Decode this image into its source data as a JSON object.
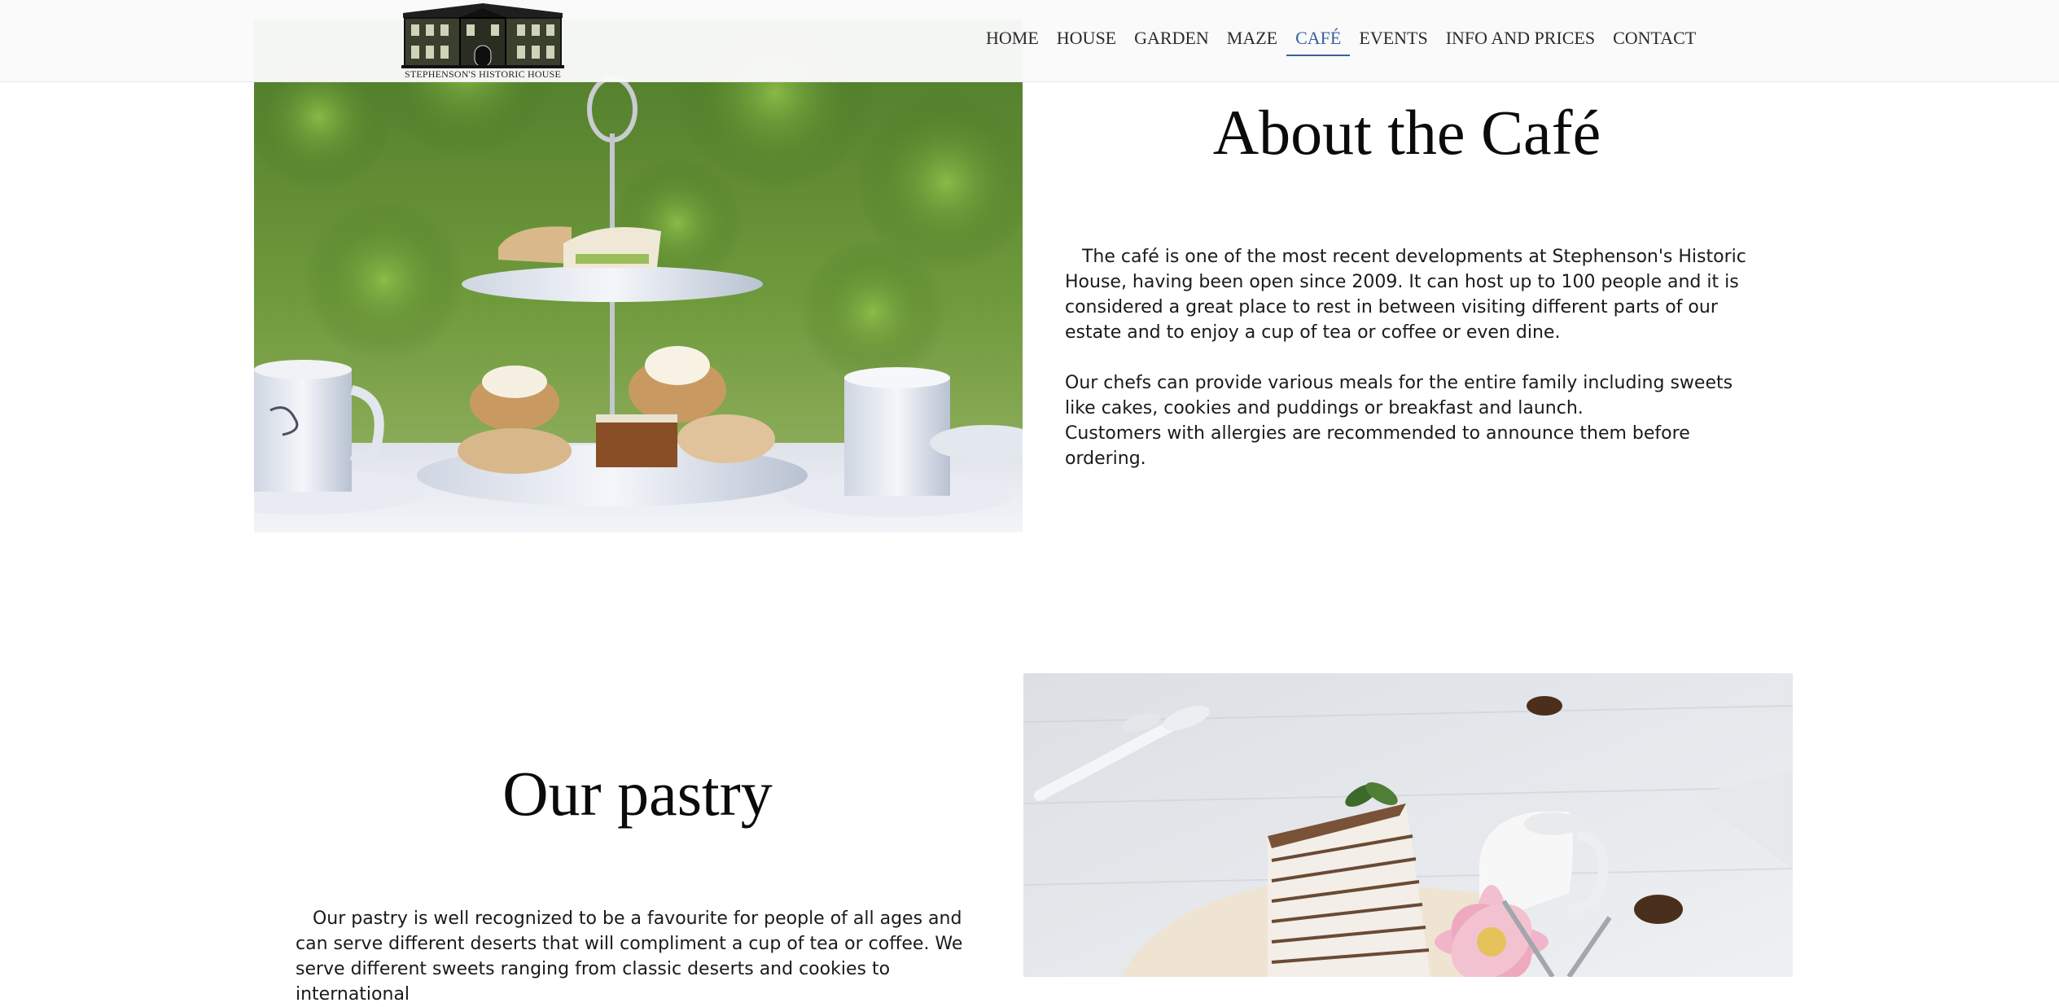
{
  "header": {
    "logo_text": "STEPHENSON'S HISTORIC HOUSE",
    "nav": [
      {
        "label": "HOME",
        "active": false
      },
      {
        "label": "HOUSE",
        "active": false
      },
      {
        "label": "GARDEN",
        "active": false
      },
      {
        "label": "MAZE",
        "active": false
      },
      {
        "label": "CAFÉ",
        "active": true
      },
      {
        "label": "EVENTS",
        "active": false
      },
      {
        "label": "INFO AND PRICES",
        "active": false
      },
      {
        "label": "CONTACT",
        "active": false
      }
    ],
    "active_color": "#3b5f9e"
  },
  "about": {
    "title": "About the Café",
    "paragraph1": "   The café is one of the most recent developments at Stephenson's Historic House, having been open since 2009. It can host up to 100 people and it is considered a great place to rest in between visiting different parts of our estate and to enjoy a cup of tea or coffee or even dine.",
    "paragraph2": "Our chefs can provide various meals for the entire family including sweets like cakes, cookies and puddings or breakfast and launch.",
    "paragraph3": "Customers with allergies are recommended to announce them before ordering."
  },
  "pastry": {
    "title": "Our pastry",
    "paragraph1": "   Our pastry is well recognized to be a favourite for people of all ages and can serve different deserts that will compliment a cup of tea or coffee. We serve different sweets ranging from classic deserts and cookies to international"
  }
}
